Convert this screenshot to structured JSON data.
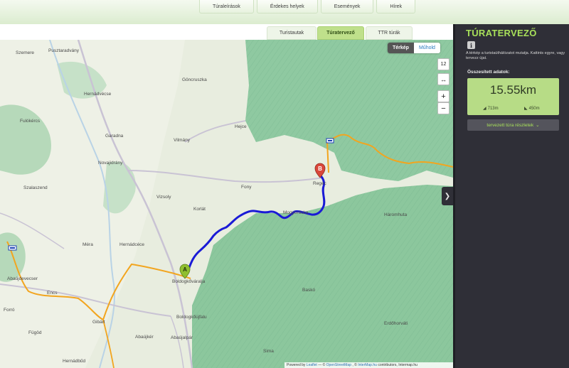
{
  "top_nav": [
    "Túraleírások",
    "Érdekes helyek",
    "Események",
    "Hírek"
  ],
  "sub_tabs": [
    "Turistautak",
    "Túratervező",
    "TTR túrák"
  ],
  "map": {
    "layer_buttons": [
      "Térkép",
      "Műhold"
    ],
    "zoom_level": "12",
    "route_marker_start": "A",
    "route_marker_end": "B",
    "places": [
      "Szemere",
      "Pusztaradvány",
      "Göncruszka",
      "Hernádvécse",
      "Fulókércs",
      "Garadna",
      "Hejce",
      "Vilmány",
      "Novajidrány",
      "Szalaszend",
      "Fony",
      "Regéc",
      "Vizsoly",
      "Korlát",
      "Mogyoróska",
      "Háromhuta",
      "Méra",
      "Hernádcéce",
      "Boldogkőváralja",
      "Abaújdevecser",
      "Encs",
      "Baskó",
      "Forró",
      "Gibárt",
      "Boldogkőújfalu",
      "Fügöd",
      "Abaújkér",
      "Abaújalpár",
      "Erdőhorváti",
      "Sima",
      "Hernádbűd"
    ],
    "attribution": [
      "Powered by",
      "Leaflet",
      "— ©",
      "OpenStreetMap",
      ", ©",
      "InterMap.hu",
      "contributors, Intermap.hu"
    ]
  },
  "panel": {
    "title": "TÚRATERVEZŐ",
    "description": "A térkép a turistaúthálózatot mutatja. Kattints egyre, vagy tervezz újat.",
    "stats_label": "Összesített adatok:",
    "distance": "15.55km",
    "ascent": "713m",
    "descent": "450m",
    "details_button": "tervezett túra részletek"
  },
  "colors": {
    "accent": "#a8e05a",
    "route": "#1a1ad6",
    "trail": "#f0a020",
    "panel_bg": "#2f2f37"
  }
}
